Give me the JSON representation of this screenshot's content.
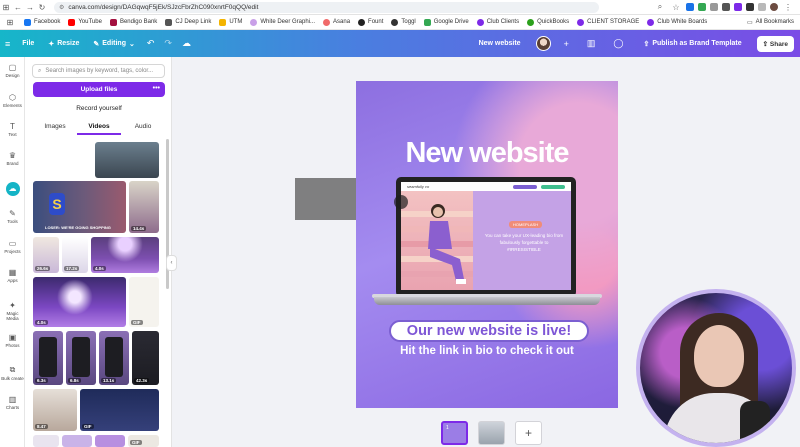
{
  "browser": {
    "url": "canva.com/design/DAGqwqF5jEk/SJzcFbrZhC090xnrtF0qQQ/edit",
    "bookmarks": [
      {
        "label": "Facebook",
        "color": "#1877f2"
      },
      {
        "label": "YouTube",
        "color": "#ff0000"
      },
      {
        "label": "Bendigo Bank",
        "color": "#a3103f"
      },
      {
        "label": "CJ Deep Link",
        "color": "#555555"
      },
      {
        "label": "UTM",
        "color": "#f4b400"
      },
      {
        "label": "White Deer Graphi...",
        "color": "#c9a0e8"
      },
      {
        "label": "Asana",
        "color": "#f06a6a"
      },
      {
        "label": "Fount",
        "color": "#222222"
      },
      {
        "label": "Toggl",
        "color": "#333333"
      },
      {
        "label": "Google Drive",
        "color": "#34a853"
      },
      {
        "label": "Club Clients",
        "color": "#7d2ae8"
      },
      {
        "label": "QuickBooks",
        "color": "#2ca01c"
      },
      {
        "label": "CLIENT STORAGE",
        "color": "#7d2ae8"
      },
      {
        "label": "Club White Boards",
        "color": "#7d2ae8"
      }
    ],
    "all_bookmarks": "All Bookmarks"
  },
  "topbar": {
    "file": "File",
    "resize": "Resize",
    "editing": "Editing",
    "doc_title": "New website",
    "publish": "Publish as Brand Template",
    "share": "Share"
  },
  "rail": {
    "items": [
      {
        "label": "Design",
        "icon": "▢"
      },
      {
        "label": "Elements",
        "icon": "⬡"
      },
      {
        "label": "Text",
        "icon": "T"
      },
      {
        "label": "Brand",
        "icon": "♛"
      },
      {
        "label": "",
        "icon": "☁"
      },
      {
        "label": "Tools",
        "icon": "✎"
      },
      {
        "label": "Projects",
        "icon": "▭"
      },
      {
        "label": "Apps",
        "icon": "▦"
      },
      {
        "label": "Magic Media",
        "icon": "✦"
      },
      {
        "label": "Photos",
        "icon": "▣"
      },
      {
        "label": "Bulk create",
        "icon": "⧉"
      },
      {
        "label": "Charts",
        "icon": "▥"
      }
    ]
  },
  "panel": {
    "search_placeholder": "Search images by keyword, tags, color...",
    "upload": "Upload files",
    "record": "Record yourself",
    "tabs": [
      "Images",
      "Videos",
      "Audio"
    ],
    "thumb_labels": {
      "t1": "14.4s",
      "t2": "26.6s",
      "t3": "17.2s",
      "t4": "4.0s",
      "t5": "4.0s",
      "t6": "GIF",
      "t7": "6.3s",
      "t8": "6.8s",
      "t9": "13.1s",
      "t10": "42.3s",
      "t11": "8.47",
      "t12": "GIF",
      "t13": "GIF"
    },
    "loser_text": "LOSER: WE'RE GOING SHOPPING"
  },
  "design": {
    "title": "New website",
    "site_logo": "seamfully co",
    "badge": "HOMEPLASH",
    "site_copy": "You can take your UX-leading bio from fabulously forgettable to #IRRESISTIBLE",
    "pill": "Our new website is live!",
    "subtitle": "Hit the link in bio to check it out"
  },
  "pages": {
    "first": "1"
  }
}
